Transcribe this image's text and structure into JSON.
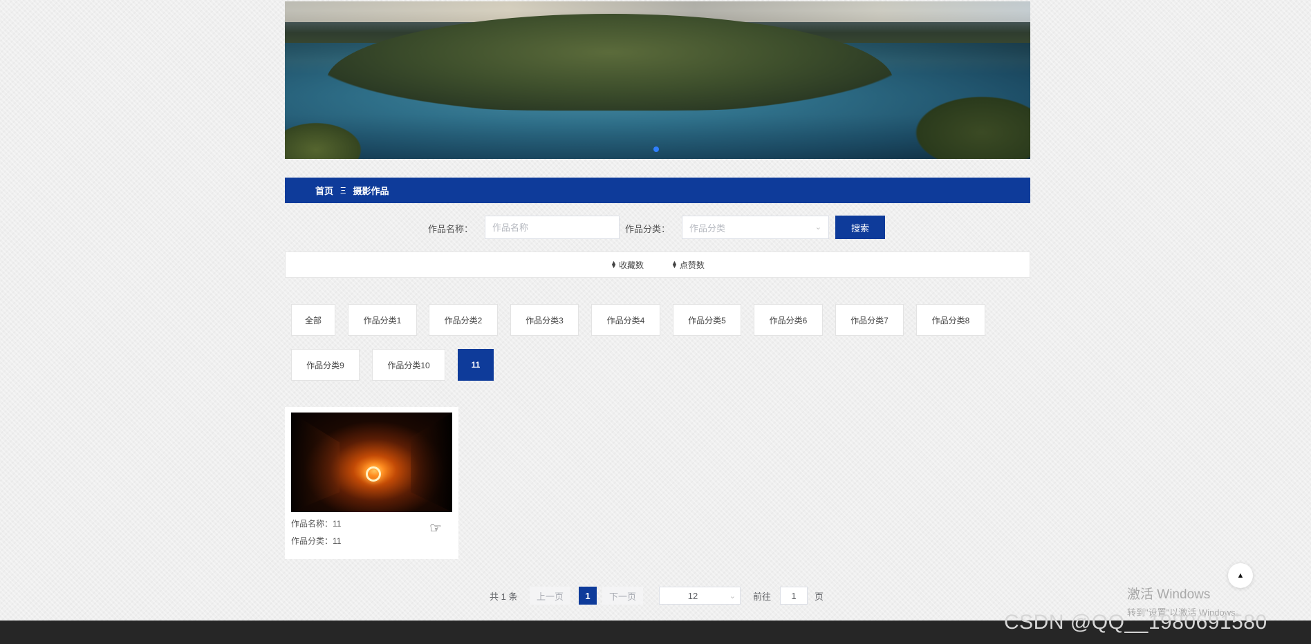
{
  "breadcrumb": {
    "home": "首页",
    "separator": "Ξ",
    "current": "摄影作品"
  },
  "search": {
    "name_label": "作品名称：",
    "name_placeholder": "作品名称",
    "category_label": "作品分类：",
    "category_placeholder": "作品分类",
    "button": "搜索"
  },
  "sort": {
    "favorites": "收藏数",
    "likes": "点赞数"
  },
  "categories": [
    "全部",
    "作品分类1",
    "作品分类2",
    "作品分类3",
    "作品分类4",
    "作品分类5",
    "作品分类6",
    "作品分类7",
    "作品分类8",
    "作品分类9",
    "作品分类10",
    "11"
  ],
  "active_category": "11",
  "works": [
    {
      "name_label": "作品名称：",
      "name": "11",
      "category_label": "作品分类：",
      "category": "11"
    }
  ],
  "pagination": {
    "total": "共 1 条",
    "prev": "上一页",
    "current_page": "1",
    "next": "下一页",
    "page_size": "12",
    "goto_label": "前往",
    "goto_value": "1",
    "page_unit": "页"
  },
  "watermark": {
    "windows_title": "激活 Windows",
    "windows_sub": "转到\"设置\"以激活 Windows。",
    "csdn": "CSDN @QQ__1980691580"
  },
  "colors": {
    "primary": "#0e3b9a",
    "footer": "#262626",
    "carousel_dot": "#2f7fff"
  }
}
